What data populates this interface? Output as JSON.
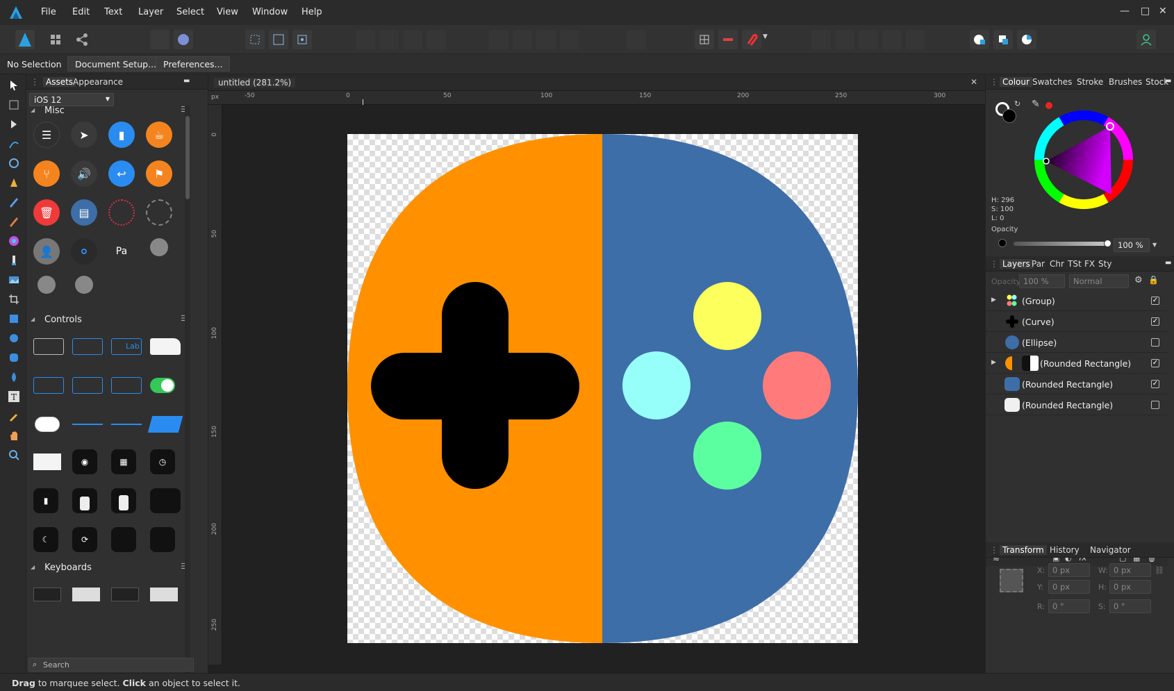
{
  "app": {
    "name": "Affinity Designer",
    "accent": "#2aa2e0"
  },
  "menu": {
    "items": [
      "File",
      "Edit",
      "Text",
      "Layer",
      "Select",
      "View",
      "Window",
      "Help"
    ]
  },
  "context": {
    "selection": "No Selection",
    "document_setup": "Document Setup...",
    "preferences": "Preferences..."
  },
  "assets_panel": {
    "tabs": [
      "Assets",
      "Appearance"
    ],
    "category": "iOS 12",
    "sections": [
      "Misc",
      "Controls",
      "Keyboards"
    ],
    "controls_label_text": "Lab",
    "search_placeholder": "Search"
  },
  "document": {
    "tab_title": "untitled (281.2%)",
    "ruler_unit": "px",
    "h_ticks": [
      "-50",
      "0",
      "50",
      "100",
      "150",
      "200",
      "250",
      "300"
    ],
    "v_ticks": [
      "0",
      "50",
      "100",
      "150",
      "200",
      "250"
    ]
  },
  "artwork": {
    "left_color": "#ff9100",
    "right_color": "#3d6ea8",
    "dpad_color": "#000000",
    "buttons": {
      "top": "#fcff5c",
      "left": "#96fffa",
      "right": "#ff7a7a",
      "bottom": "#5cff9f"
    }
  },
  "colour_panel": {
    "tabs": [
      "Colour",
      "Swatches",
      "Stroke",
      "Brushes",
      "Stock"
    ],
    "h": "H: 296",
    "s": "S: 100",
    "l": "L: 0",
    "opacity_label": "Opacity",
    "opacity_value": "100 %"
  },
  "layers_panel": {
    "tabs": [
      "Layers",
      "Par",
      "Chr",
      "TSt",
      "FX",
      "Sty"
    ],
    "opacity_label": "Opacity:",
    "opacity_value": "100 %",
    "blend_mode": "Normal",
    "layers": [
      {
        "name": "(Group)",
        "visible": true,
        "expandable": true
      },
      {
        "name": "(Curve)",
        "visible": true,
        "expandable": false
      },
      {
        "name": "(Ellipse)",
        "visible": false,
        "expandable": false
      },
      {
        "name": "(Rounded Rectangle)",
        "visible": true,
        "expandable": true
      },
      {
        "name": "(Rounded Rectangle)",
        "visible": true,
        "expandable": false
      },
      {
        "name": "(Rounded Rectangle)",
        "visible": false,
        "expandable": false
      }
    ]
  },
  "transform_panel": {
    "tabs": [
      "Transform",
      "History",
      "Navigator"
    ],
    "x_label": "X:",
    "x_value": "0 px",
    "y_label": "Y:",
    "y_value": "0 px",
    "w_label": "W:",
    "w_value": "0 px",
    "h_label": "H:",
    "h_value": "0 px",
    "r_label": "R:",
    "r_value": "0 °",
    "s_label": "S:",
    "s_value": "0 °"
  },
  "status": {
    "bold1": "Drag",
    "text1": " to marquee select. ",
    "bold2": "Click",
    "text2": " an object to select it."
  }
}
